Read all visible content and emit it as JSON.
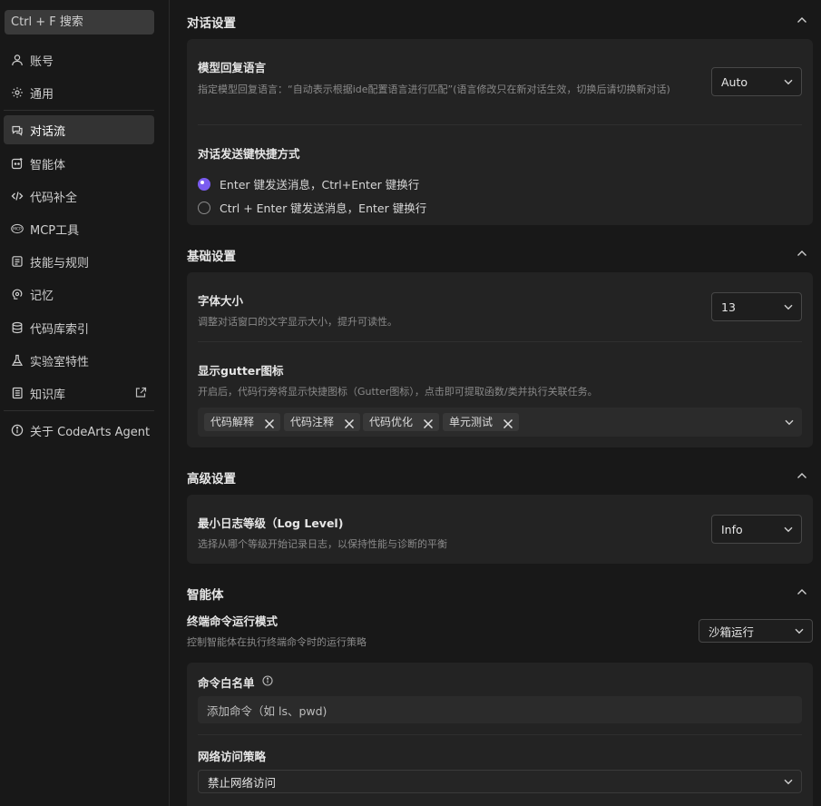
{
  "search": {
    "placeholder": "Ctrl + F 搜索"
  },
  "sidebar": {
    "items": [
      {
        "label": "账号",
        "icon": "user-icon"
      },
      {
        "label": "通用",
        "icon": "gear-icon"
      },
      {
        "label": "对话流",
        "icon": "chat-icon",
        "active": true
      },
      {
        "label": "智能体",
        "icon": "agent-icon"
      },
      {
        "label": "代码补全",
        "icon": "code-icon"
      },
      {
        "label": "MCP工具",
        "icon": "mcp-icon"
      },
      {
        "label": "技能与规则",
        "icon": "rules-icon"
      },
      {
        "label": "记忆",
        "icon": "brain-icon"
      },
      {
        "label": "代码库索引",
        "icon": "database-icon"
      },
      {
        "label": "实验室特性",
        "icon": "flask-icon"
      },
      {
        "label": "知识库",
        "icon": "book-icon",
        "external": "external-link-icon"
      },
      {
        "label": "关于 CodeArts Agent",
        "icon": "info-icon"
      }
    ]
  },
  "sections": {
    "dialog": {
      "title": "对话设置",
      "reply_language": {
        "label": "模型回复语言",
        "desc": "指定模型回复语言：“自动表示根据ide配置语言进行匹配”(语言修改只在新对话生效，切换后请切换新对话)",
        "value": "Auto"
      },
      "send_shortcut": {
        "label": "对话发送键快捷方式",
        "options": [
          {
            "label": "Enter 键发送消息，Ctrl+Enter 键换行",
            "selected": true
          },
          {
            "label": "Ctrl + Enter 键发送消息，Enter 键换行",
            "selected": false
          }
        ]
      }
    },
    "basic": {
      "title": "基础设置",
      "font_size": {
        "label": "字体大小",
        "desc": "调整对话窗口的文字显示大小，提升可读性。",
        "value": "13"
      },
      "gutter": {
        "label": "显示gutter图标",
        "desc": "开启后，代码行旁将显示快捷图标（Gutter图标），点击即可提取函数/类并执行关联任务。",
        "tags": [
          "代码解释",
          "代码注释",
          "代码优化",
          "单元测试"
        ]
      }
    },
    "advanced": {
      "title": "高级设置",
      "log_level": {
        "label": "最小日志等级（Log Level)",
        "desc": "选择从哪个等级开始记录日志，以保持性能与诊断的平衡",
        "value": "Info"
      }
    },
    "agent": {
      "title": "智能体",
      "terminal_mode": {
        "label": "终端命令运行模式",
        "desc": "控制智能体在执行终端命令时的运行策略",
        "value": "沙箱运行"
      },
      "whitelist": {
        "label": "命令白名单",
        "placeholder": "添加命令（如 ls、pwd)"
      },
      "network": {
        "label": "网络访问策略",
        "value": "禁止网络访问"
      }
    }
  },
  "colors": {
    "accent": "#7a5cf0",
    "background": "#181818",
    "card": "#232323"
  }
}
